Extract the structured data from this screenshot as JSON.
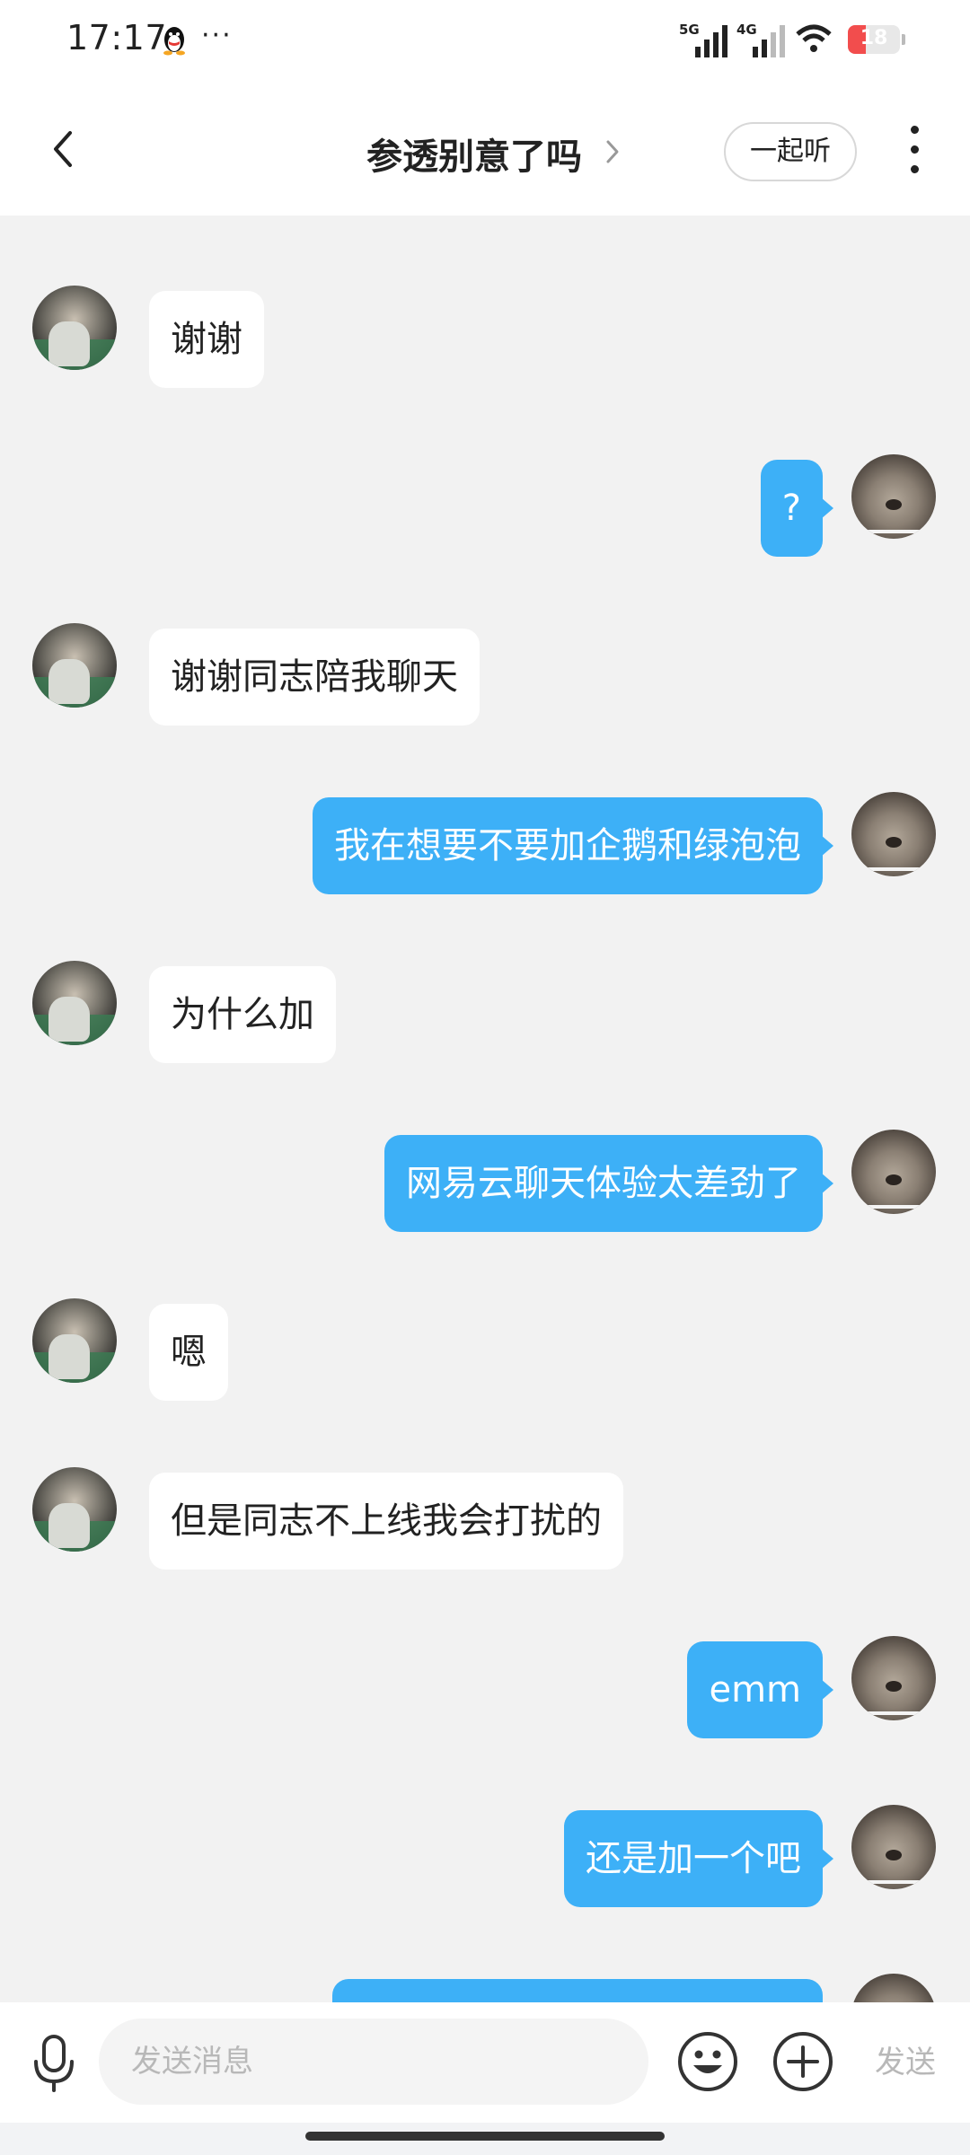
{
  "status_bar": {
    "time": "17:17",
    "more": "···",
    "network1": "5G",
    "network2": "4G",
    "battery_level": "18",
    "battery_color": "#f24d4d"
  },
  "header": {
    "title": "参透别意了吗",
    "listen_together": "一起听",
    "back_icon": "chevron-left-icon",
    "more_icon": "more-vertical-icon"
  },
  "messages": [
    {
      "side": "left",
      "text": "谢谢"
    },
    {
      "side": "right",
      "text": "?"
    },
    {
      "side": "left",
      "text": "谢谢同志陪我聊天"
    },
    {
      "side": "right",
      "text": "我在想要不要加企鹅和绿泡泡"
    },
    {
      "side": "left",
      "text": "为什么加"
    },
    {
      "side": "right",
      "text": "网易云聊天体验太差劲了"
    },
    {
      "side": "left",
      "text": "嗯"
    },
    {
      "side": "left",
      "text": "但是同志不上线我会打扰的"
    },
    {
      "side": "right",
      "text": "emm"
    },
    {
      "side": "right",
      "text": "还是加一个吧"
    },
    {
      "side": "right",
      "text": ""
    }
  ],
  "input_bar": {
    "placeholder": "发送消息",
    "send_label": "发送",
    "mic_icon": "microphone-icon",
    "emoji_icon": "emoji-icon",
    "plus_icon": "plus-circle-icon"
  },
  "colors": {
    "bubble_self": "#3db0f7",
    "bubble_other": "#ffffff",
    "chat_background": "#f2f2f2"
  }
}
